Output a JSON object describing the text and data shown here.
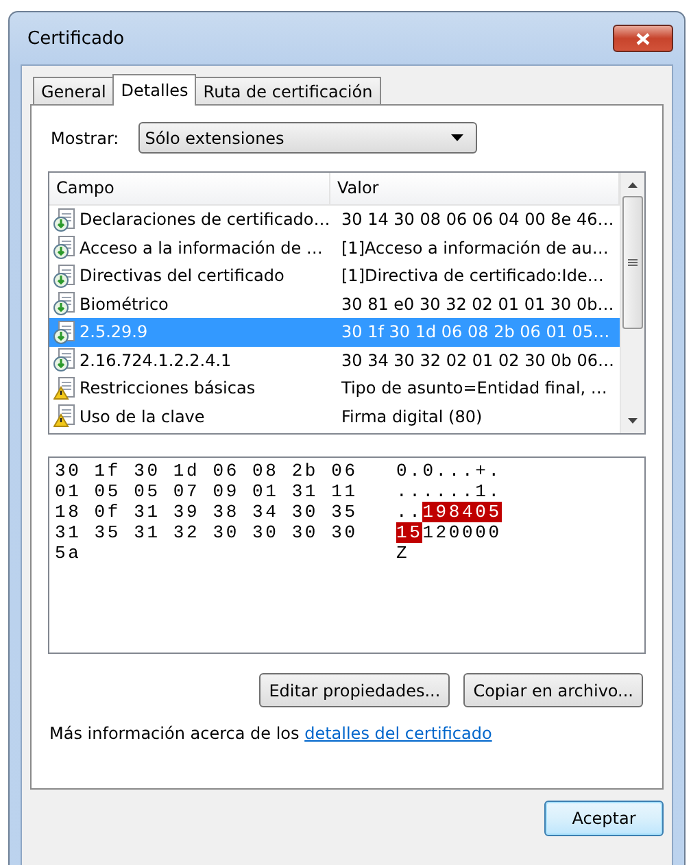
{
  "window": {
    "title": "Certificado"
  },
  "tabs": [
    {
      "label": "General",
      "selected": false
    },
    {
      "label": "Detalles",
      "selected": true
    },
    {
      "label": "Ruta de certificación",
      "selected": false
    }
  ],
  "show": {
    "label": "Mostrar:",
    "value": "Sólo extensiones"
  },
  "fields": {
    "columns": [
      "Campo",
      "Valor"
    ],
    "rows": [
      {
        "kind": "extension",
        "field": "Declaraciones de certificado…",
        "value": "30 14 30 08 06 06 04 00 8e 46…",
        "selected": false
      },
      {
        "kind": "extension",
        "field": "Acceso a la información de …",
        "value": "[1]Acceso a información de au…",
        "selected": false
      },
      {
        "kind": "extension",
        "field": "Directivas del certificado",
        "value": "[1]Directiva de certificado:Ide…",
        "selected": false
      },
      {
        "kind": "extension",
        "field": "Biométrico",
        "value": "30 81 e0 30 32 02 01 01 30 0b…",
        "selected": false
      },
      {
        "kind": "extension",
        "field": "2.5.29.9",
        "value": "30 1f 30 1d 06 08 2b 06 01 05…",
        "selected": true
      },
      {
        "kind": "extension",
        "field": "2.16.724.1.2.2.4.1",
        "value": "30 34 30 32 02 01 02 30 0b 06…",
        "selected": false
      },
      {
        "kind": "critical",
        "field": "Restricciones básicas",
        "value": "Tipo de asunto=Entidad final, …",
        "selected": false
      },
      {
        "kind": "critical",
        "field": "Uso de la clave",
        "value": "Firma digital (80)",
        "selected": false
      }
    ]
  },
  "dump": [
    {
      "hex": "30 1f 30 1d 06 08 2b 06",
      "ascii": [
        {
          "text": "0.0...+.",
          "selected": false
        }
      ]
    },
    {
      "hex": "01 05 05 07 09 01 31 11",
      "ascii": [
        {
          "text": "......1.",
          "selected": false
        }
      ]
    },
    {
      "hex": "18 0f 31 39 38 34 30 35",
      "ascii": [
        {
          "text": "..",
          "selected": false
        },
        {
          "text": "198405",
          "selected": true
        }
      ]
    },
    {
      "hex": "31 35 31 32 30 30 30 30",
      "ascii": [
        {
          "text": "15",
          "selected": true
        },
        {
          "text": "120000",
          "selected": false
        }
      ]
    },
    {
      "hex": "5a",
      "ascii": [
        {
          "text": "Z",
          "selected": false
        }
      ]
    }
  ],
  "buttons": [
    "Editar propiedades...",
    "Copiar en archivo..."
  ],
  "info": {
    "text": "Más información acerca de los",
    "link": "detalles del certificado"
  },
  "ok": "Aceptar"
}
